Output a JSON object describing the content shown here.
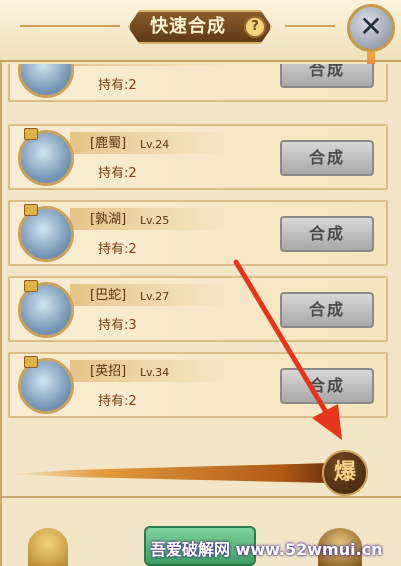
{
  "header": {
    "title": "快速合成",
    "help_label": "?",
    "close_label": "✕"
  },
  "items": [
    {
      "name": "",
      "level": "",
      "owned": "持有:2",
      "button": "合成"
    },
    {
      "name": "[鹿蜀]",
      "level": "Lv.24",
      "owned": "持有:2",
      "button": "合成"
    },
    {
      "name": "[孰湖]",
      "level": "Lv.25",
      "owned": "持有:2",
      "button": "合成"
    },
    {
      "name": "[巴蛇]",
      "level": "Lv.27",
      "owned": "持有:3",
      "button": "合成"
    },
    {
      "name": "[英招]",
      "level": "Lv.34",
      "owned": "持有:2",
      "button": "合成"
    }
  ],
  "explode_label": "爆",
  "watermark": "吾爱破解网 www.52wmui.cn",
  "colors": {
    "arrow": "#e8341c",
    "panel": "#f3e6c8",
    "button_gray": "#b8b8b8",
    "accent_gold": "#c9a25c"
  },
  "icons": [
    "help-icon",
    "close-icon",
    "lock-icon",
    "explode-badge"
  ]
}
